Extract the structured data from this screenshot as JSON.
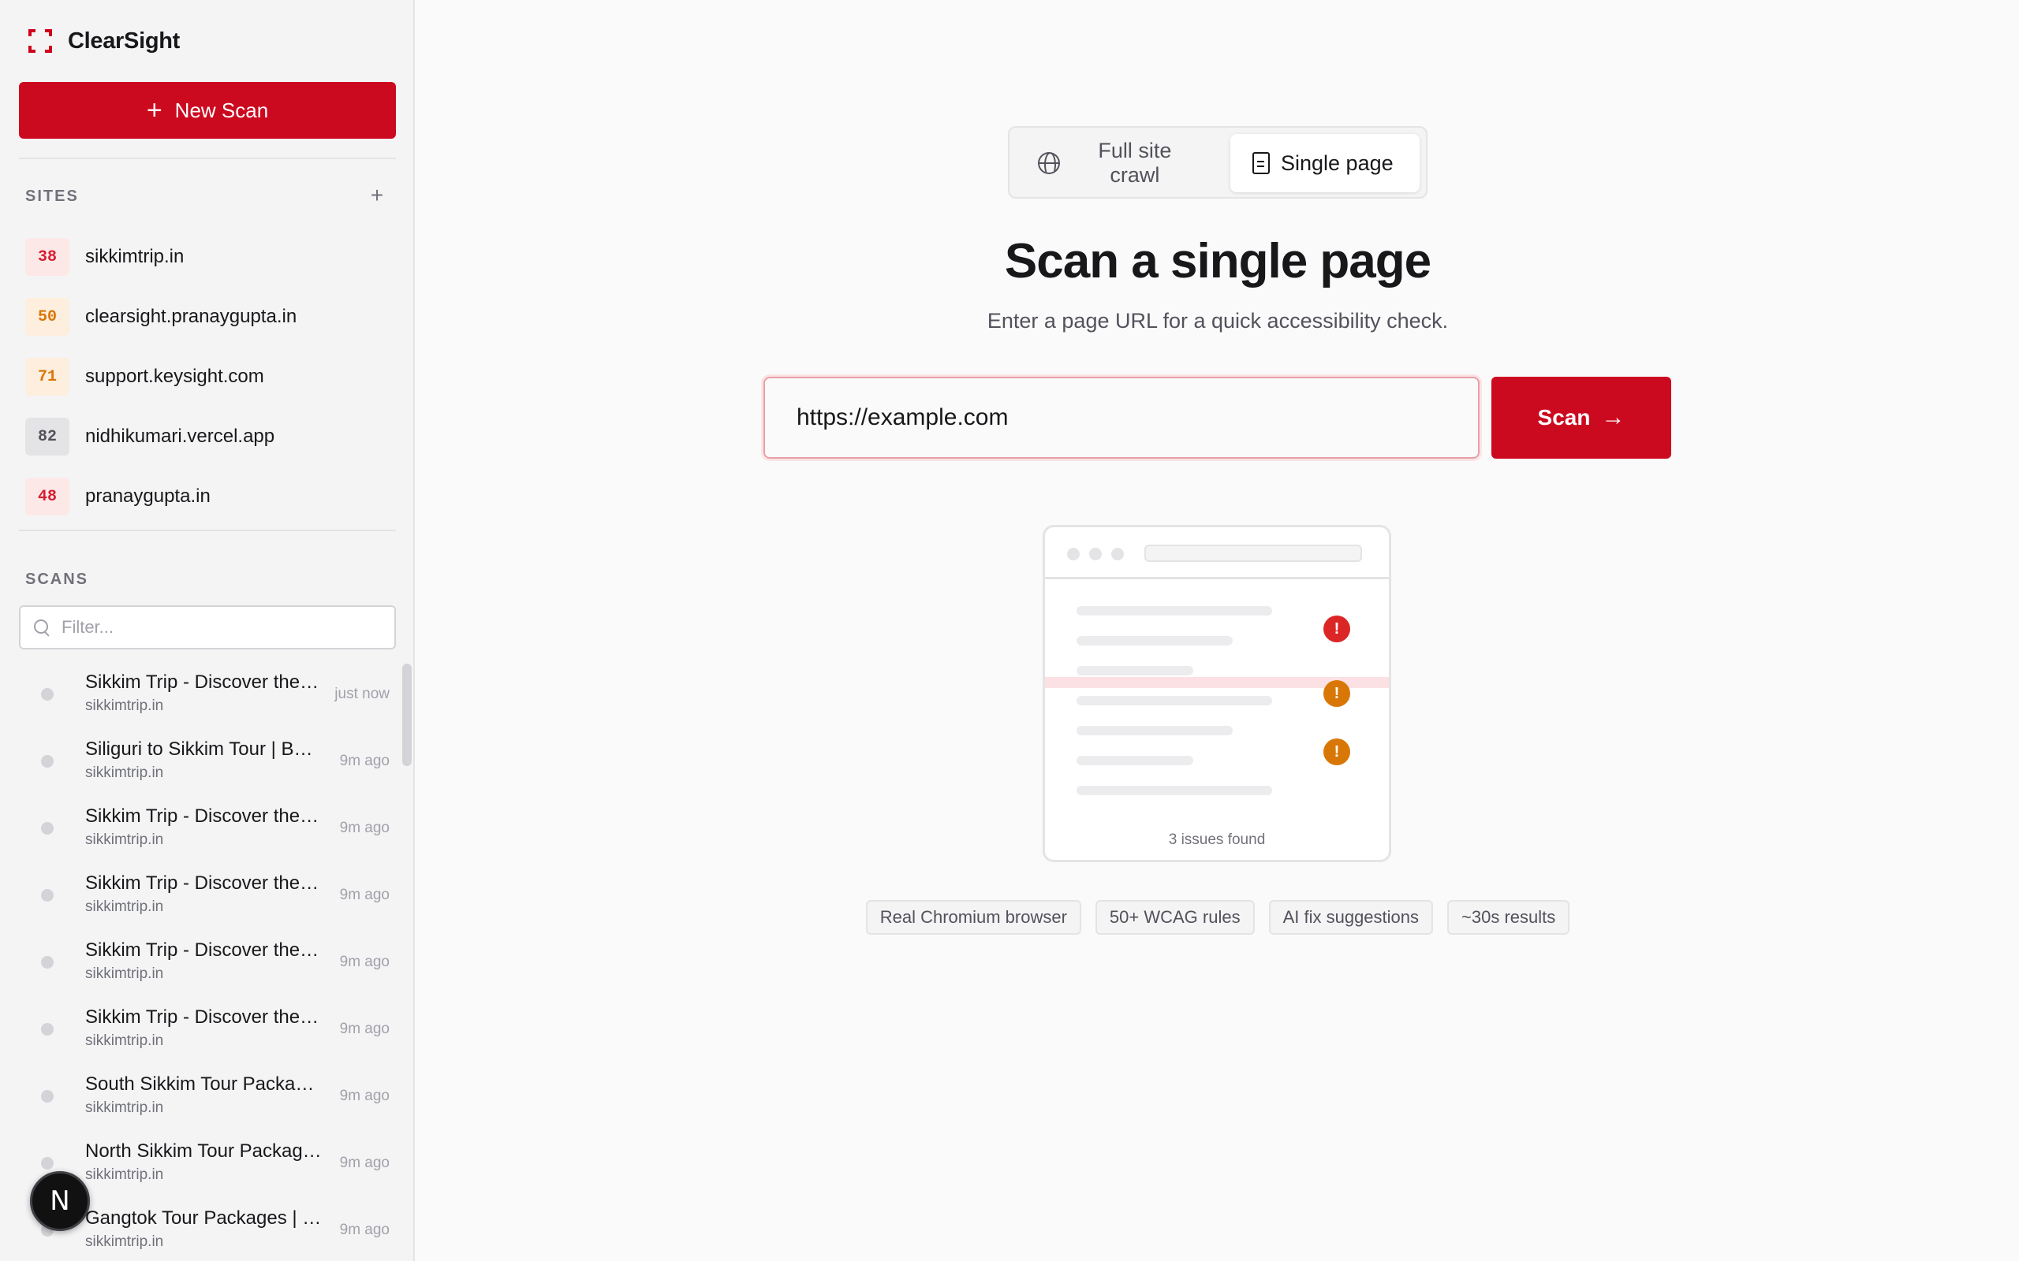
{
  "brand": {
    "name": "ClearSight"
  },
  "sidebar": {
    "new_scan_label": "New Scan",
    "sites_label": "SITES",
    "sites": [
      {
        "score": "38",
        "name": "sikkimtrip.in",
        "color": "#d42033"
      },
      {
        "score": "50",
        "name": "clearsight.pranaygupta.in",
        "color": "#d97706"
      },
      {
        "score": "71",
        "name": "support.keysight.com",
        "color": "#d97706"
      },
      {
        "score": "82",
        "name": "nidhikumari.vercel.app",
        "color": "#52525b"
      },
      {
        "score": "48",
        "name": "pranaygupta.in",
        "color": "#d42033"
      }
    ],
    "scans_label": "SCANS",
    "filter_placeholder": "Filter...",
    "scans": [
      {
        "title": "Sikkim Trip - Discover the Beauty of Sikkim",
        "site": "sikkimtrip.in",
        "time": "just now"
      },
      {
        "title": "Siliguri to Sikkim Tour | Best Packages",
        "site": "sikkimtrip.in",
        "time": "9m ago"
      },
      {
        "title": "Sikkim Trip - Discover the Beauty of Sikkim",
        "site": "sikkimtrip.in",
        "time": "9m ago"
      },
      {
        "title": "Sikkim Trip - Discover the Beauty of Sikkim",
        "site": "sikkimtrip.in",
        "time": "9m ago"
      },
      {
        "title": "Sikkim Trip - Discover the Beauty of Sikkim",
        "site": "sikkimtrip.in",
        "time": "9m ago"
      },
      {
        "title": "Sikkim Trip - Discover the Beauty of Sikkim",
        "site": "sikkimtrip.in",
        "time": "9m ago"
      },
      {
        "title": "South Sikkim Tour Packages",
        "site": "sikkimtrip.in",
        "time": "9m ago"
      },
      {
        "title": "North Sikkim Tour Packages",
        "site": "sikkimtrip.in",
        "time": "9m ago"
      },
      {
        "title": "Gangtok Tour Packages | Best Deals",
        "site": "sikkimtrip.in",
        "time": "9m ago"
      }
    ],
    "dev_badge": "N"
  },
  "main": {
    "toggle": {
      "full_site": "Full site crawl",
      "single_page": "Single page"
    },
    "title": "Scan a single page",
    "subtitle": "Enter a page URL for a quick accessibility check.",
    "url_value": "https://example.com",
    "scan_label": "Scan",
    "illustration": {
      "caption": "3 issues found",
      "mark": "!"
    },
    "features": [
      "Real Chromium browser",
      "50+ WCAG rules",
      "AI fix suggestions",
      "~30s results"
    ]
  },
  "colors": {
    "accent": "#cc0a1f",
    "issue_red": "#dc2626",
    "issue_orange": "#d97706"
  }
}
